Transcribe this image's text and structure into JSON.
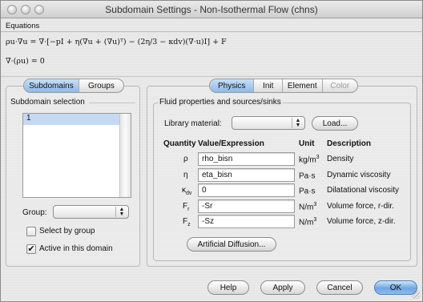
{
  "window": {
    "title": "Subdomain Settings - Non-Isothermal Flow (chns)"
  },
  "equations": {
    "label": "Equations",
    "line1": "ρu·∇u = ∇·[−pI + η(∇u + (∇u)ᵀ) − (2η/3 − κdv)(∇·u)I] + F",
    "line2": "∇·(ρu) = 0"
  },
  "left_panel": {
    "tabs": [
      {
        "label": "Subdomains",
        "selected": true
      },
      {
        "label": "Groups",
        "selected": false
      }
    ],
    "selection_label": "Subdomain selection",
    "subdomains": [
      "1"
    ],
    "group_label": "Group:",
    "group_value": "",
    "select_by_group": {
      "label": "Select by group",
      "checked": false
    },
    "active_in_domain": {
      "label": "Active in this domain",
      "checked": true
    }
  },
  "right_panel": {
    "tabs": [
      {
        "label": "Physics",
        "selected": true,
        "enabled": true
      },
      {
        "label": "Init",
        "selected": false,
        "enabled": true
      },
      {
        "label": "Element",
        "selected": false,
        "enabled": true
      },
      {
        "label": "Color",
        "selected": false,
        "enabled": false
      }
    ],
    "group_title": "Fluid properties and sources/sinks",
    "library_label": "Library material:",
    "library_value": "",
    "load_button": "Load...",
    "columns": {
      "quantity": "Quantity",
      "value": "Value/Expression",
      "unit": "Unit",
      "description": "Description"
    },
    "rows": [
      {
        "quantity": "ρ",
        "sub": "",
        "value": "rho_bisn",
        "unit": "kg/m",
        "unit_sup": "3",
        "description": "Density"
      },
      {
        "quantity": "η",
        "sub": "",
        "value": "eta_bisn",
        "unit": "Pa·s",
        "unit_sup": "",
        "description": "Dynamic viscosity"
      },
      {
        "quantity": "κ",
        "sub": "dv",
        "value": "0",
        "unit": "Pa·s",
        "unit_sup": "",
        "description": "Dilatational viscosity"
      },
      {
        "quantity": "F",
        "sub": "r",
        "value": "-Sr",
        "unit": "N/m",
        "unit_sup": "3",
        "description": "Volume force, r-dir."
      },
      {
        "quantity": "F",
        "sub": "z",
        "value": "-Sz",
        "unit": "N/m",
        "unit_sup": "3",
        "description": "Volume force, z-dir."
      }
    ],
    "artificial_diffusion_button": "Artificial Diffusion..."
  },
  "buttons": {
    "help": "Help",
    "apply": "Apply",
    "cancel": "Cancel",
    "ok": "OK"
  },
  "colors": {
    "selection": "#c5d9f3",
    "default_button": "#6fa6e2"
  }
}
